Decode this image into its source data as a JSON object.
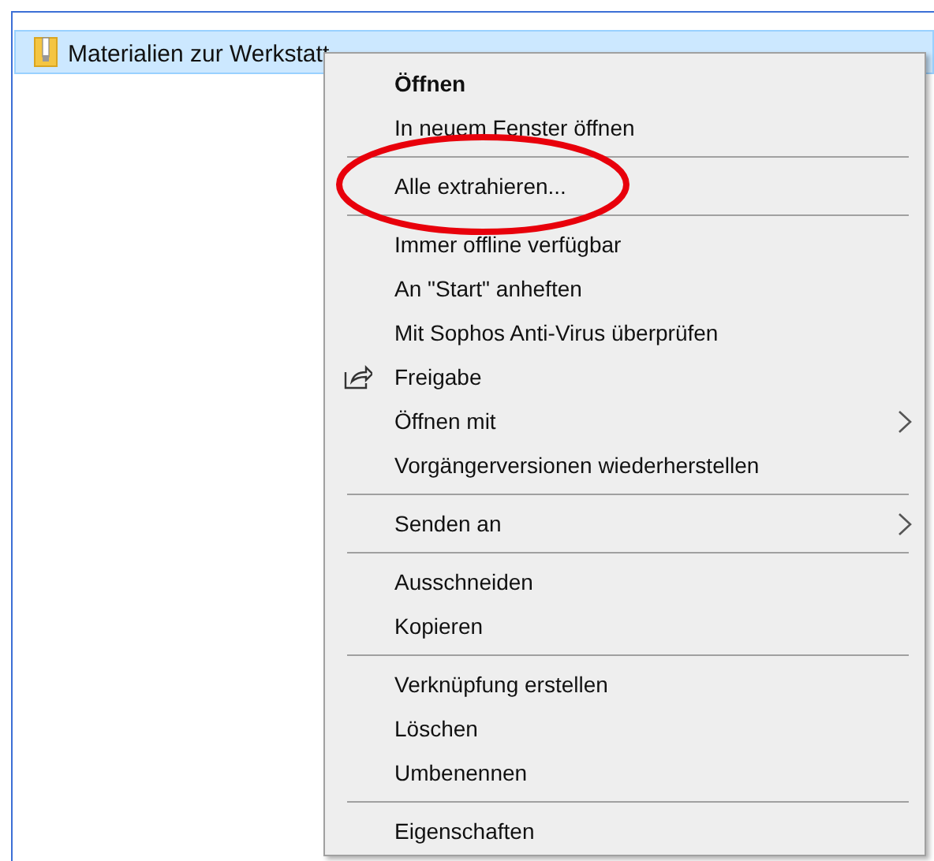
{
  "file_row": {
    "name": "Materialien zur Werkstatt",
    "selected": true
  },
  "context_menu": {
    "groups": [
      [
        {
          "label": "Öffnen",
          "kind": "plain",
          "default": true,
          "submenu": false
        },
        {
          "label": "In neuem Fenster öffnen",
          "kind": "plain",
          "default": false,
          "submenu": false
        }
      ],
      [
        {
          "label": "Alle extrahieren...",
          "kind": "plain",
          "default": false,
          "submenu": false,
          "circled": true
        }
      ],
      [
        {
          "label": "Immer offline verfügbar",
          "kind": "plain",
          "default": false,
          "submenu": false
        },
        {
          "label": "An \"Start\" anheften",
          "kind": "plain",
          "default": false,
          "submenu": false
        },
        {
          "label": "Mit Sophos Anti-Virus überprüfen",
          "kind": "plain",
          "default": false,
          "submenu": false
        },
        {
          "label": "Freigabe",
          "kind": "share",
          "default": false,
          "submenu": false
        },
        {
          "label": "Öffnen mit",
          "kind": "plain",
          "default": false,
          "submenu": true
        },
        {
          "label": "Vorgängerversionen wiederherstellen",
          "kind": "plain",
          "default": false,
          "submenu": false
        }
      ],
      [
        {
          "label": "Senden an",
          "kind": "plain",
          "default": false,
          "submenu": true
        }
      ],
      [
        {
          "label": "Ausschneiden",
          "kind": "plain",
          "default": false,
          "submenu": false
        },
        {
          "label": "Kopieren",
          "kind": "plain",
          "default": false,
          "submenu": false
        }
      ],
      [
        {
          "label": "Verknüpfung erstellen",
          "kind": "plain",
          "default": false,
          "submenu": false
        },
        {
          "label": "Löschen",
          "kind": "plain",
          "default": false,
          "submenu": false
        },
        {
          "label": "Umbenennen",
          "kind": "plain",
          "default": false,
          "submenu": false
        }
      ],
      [
        {
          "label": "Eigenschaften",
          "kind": "plain",
          "default": false,
          "submenu": false
        }
      ]
    ]
  }
}
